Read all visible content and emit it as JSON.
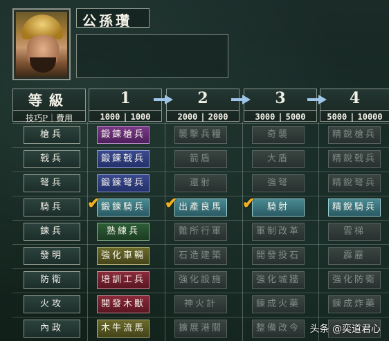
{
  "general": {
    "name": "公孫瓚"
  },
  "header": {
    "level_label": "等級",
    "tech_cost_label": "技巧P｜費用",
    "levels": [
      {
        "num": "1",
        "tech": "1000",
        "cost": "1000"
      },
      {
        "num": "2",
        "tech": "2000",
        "cost": "2000"
      },
      {
        "num": "3",
        "tech": "3000",
        "cost": "5000"
      },
      {
        "num": "4",
        "tech": "5000",
        "cost": "10000"
      }
    ]
  },
  "rows": [
    {
      "label": "槍兵",
      "cells": [
        {
          "text": "鍛鍊槍兵",
          "style": "purple",
          "learned": false
        },
        {
          "text": "襲擊兵糧",
          "style": "dim",
          "learned": false
        },
        {
          "text": "奇襲",
          "style": "dim",
          "learned": false
        },
        {
          "text": "精銳槍兵",
          "style": "dim",
          "learned": false
        }
      ]
    },
    {
      "label": "戟兵",
      "cells": [
        {
          "text": "鍛鍊戟兵",
          "style": "blue",
          "learned": false
        },
        {
          "text": "箭盾",
          "style": "dim",
          "learned": false
        },
        {
          "text": "大盾",
          "style": "dim",
          "learned": false
        },
        {
          "text": "精銳戟兵",
          "style": "dim",
          "learned": false
        }
      ]
    },
    {
      "label": "弩兵",
      "cells": [
        {
          "text": "鍛鍊弩兵",
          "style": "blue",
          "learned": false
        },
        {
          "text": "還射",
          "style": "dim",
          "learned": false
        },
        {
          "text": "強弩",
          "style": "dim",
          "learned": false
        },
        {
          "text": "精銳弩兵",
          "style": "dim",
          "learned": false
        }
      ]
    },
    {
      "label": "騎兵",
      "cells": [
        {
          "text": "鍛鍊騎兵",
          "style": "teal",
          "learned": true
        },
        {
          "text": "出產良馬",
          "style": "teal",
          "learned": true
        },
        {
          "text": "騎射",
          "style": "teal",
          "learned": true
        },
        {
          "text": "精銳騎兵",
          "style": "teal",
          "learned": false
        }
      ]
    },
    {
      "label": "鍊兵",
      "cells": [
        {
          "text": "熟練兵",
          "style": "green",
          "learned": false
        },
        {
          "text": "難所行軍",
          "style": "dim",
          "learned": false
        },
        {
          "text": "軍制改革",
          "style": "dim",
          "learned": false
        },
        {
          "text": "雲梯",
          "style": "dim",
          "learned": false
        }
      ]
    },
    {
      "label": "發明",
      "cells": [
        {
          "text": "強化車輛",
          "style": "olive",
          "learned": false
        },
        {
          "text": "石造建築",
          "style": "dim",
          "learned": false
        },
        {
          "text": "開發投石",
          "style": "dim",
          "learned": false
        },
        {
          "text": "霹靂",
          "style": "dim",
          "learned": false
        }
      ]
    },
    {
      "label": "防衛",
      "cells": [
        {
          "text": "培訓工兵",
          "style": "crimson",
          "learned": false
        },
        {
          "text": "強化設施",
          "style": "dim",
          "learned": false
        },
        {
          "text": "強化城牆",
          "style": "dim",
          "learned": false
        },
        {
          "text": "強化防衛",
          "style": "dim",
          "learned": false
        }
      ]
    },
    {
      "label": "火攻",
      "cells": [
        {
          "text": "開發木獸",
          "style": "crimson",
          "learned": false
        },
        {
          "text": "神火計",
          "style": "dim",
          "learned": false
        },
        {
          "text": "鍊成火藥",
          "style": "dim",
          "learned": false
        },
        {
          "text": "鍊成炸藥",
          "style": "dim",
          "learned": false
        }
      ]
    },
    {
      "label": "內政",
      "cells": [
        {
          "text": "木牛流馬",
          "style": "olive",
          "learned": false
        },
        {
          "text": "擴展港關",
          "style": "dim",
          "learned": false
        },
        {
          "text": "整備改今",
          "style": "dim",
          "learned": false
        },
        {
          "text": "",
          "style": "dim",
          "learned": false
        }
      ]
    }
  ],
  "watermark": "头条 @奕道君心",
  "icons": {
    "learned": "checkmark-icon",
    "arrow": "arrow-right-icon"
  }
}
